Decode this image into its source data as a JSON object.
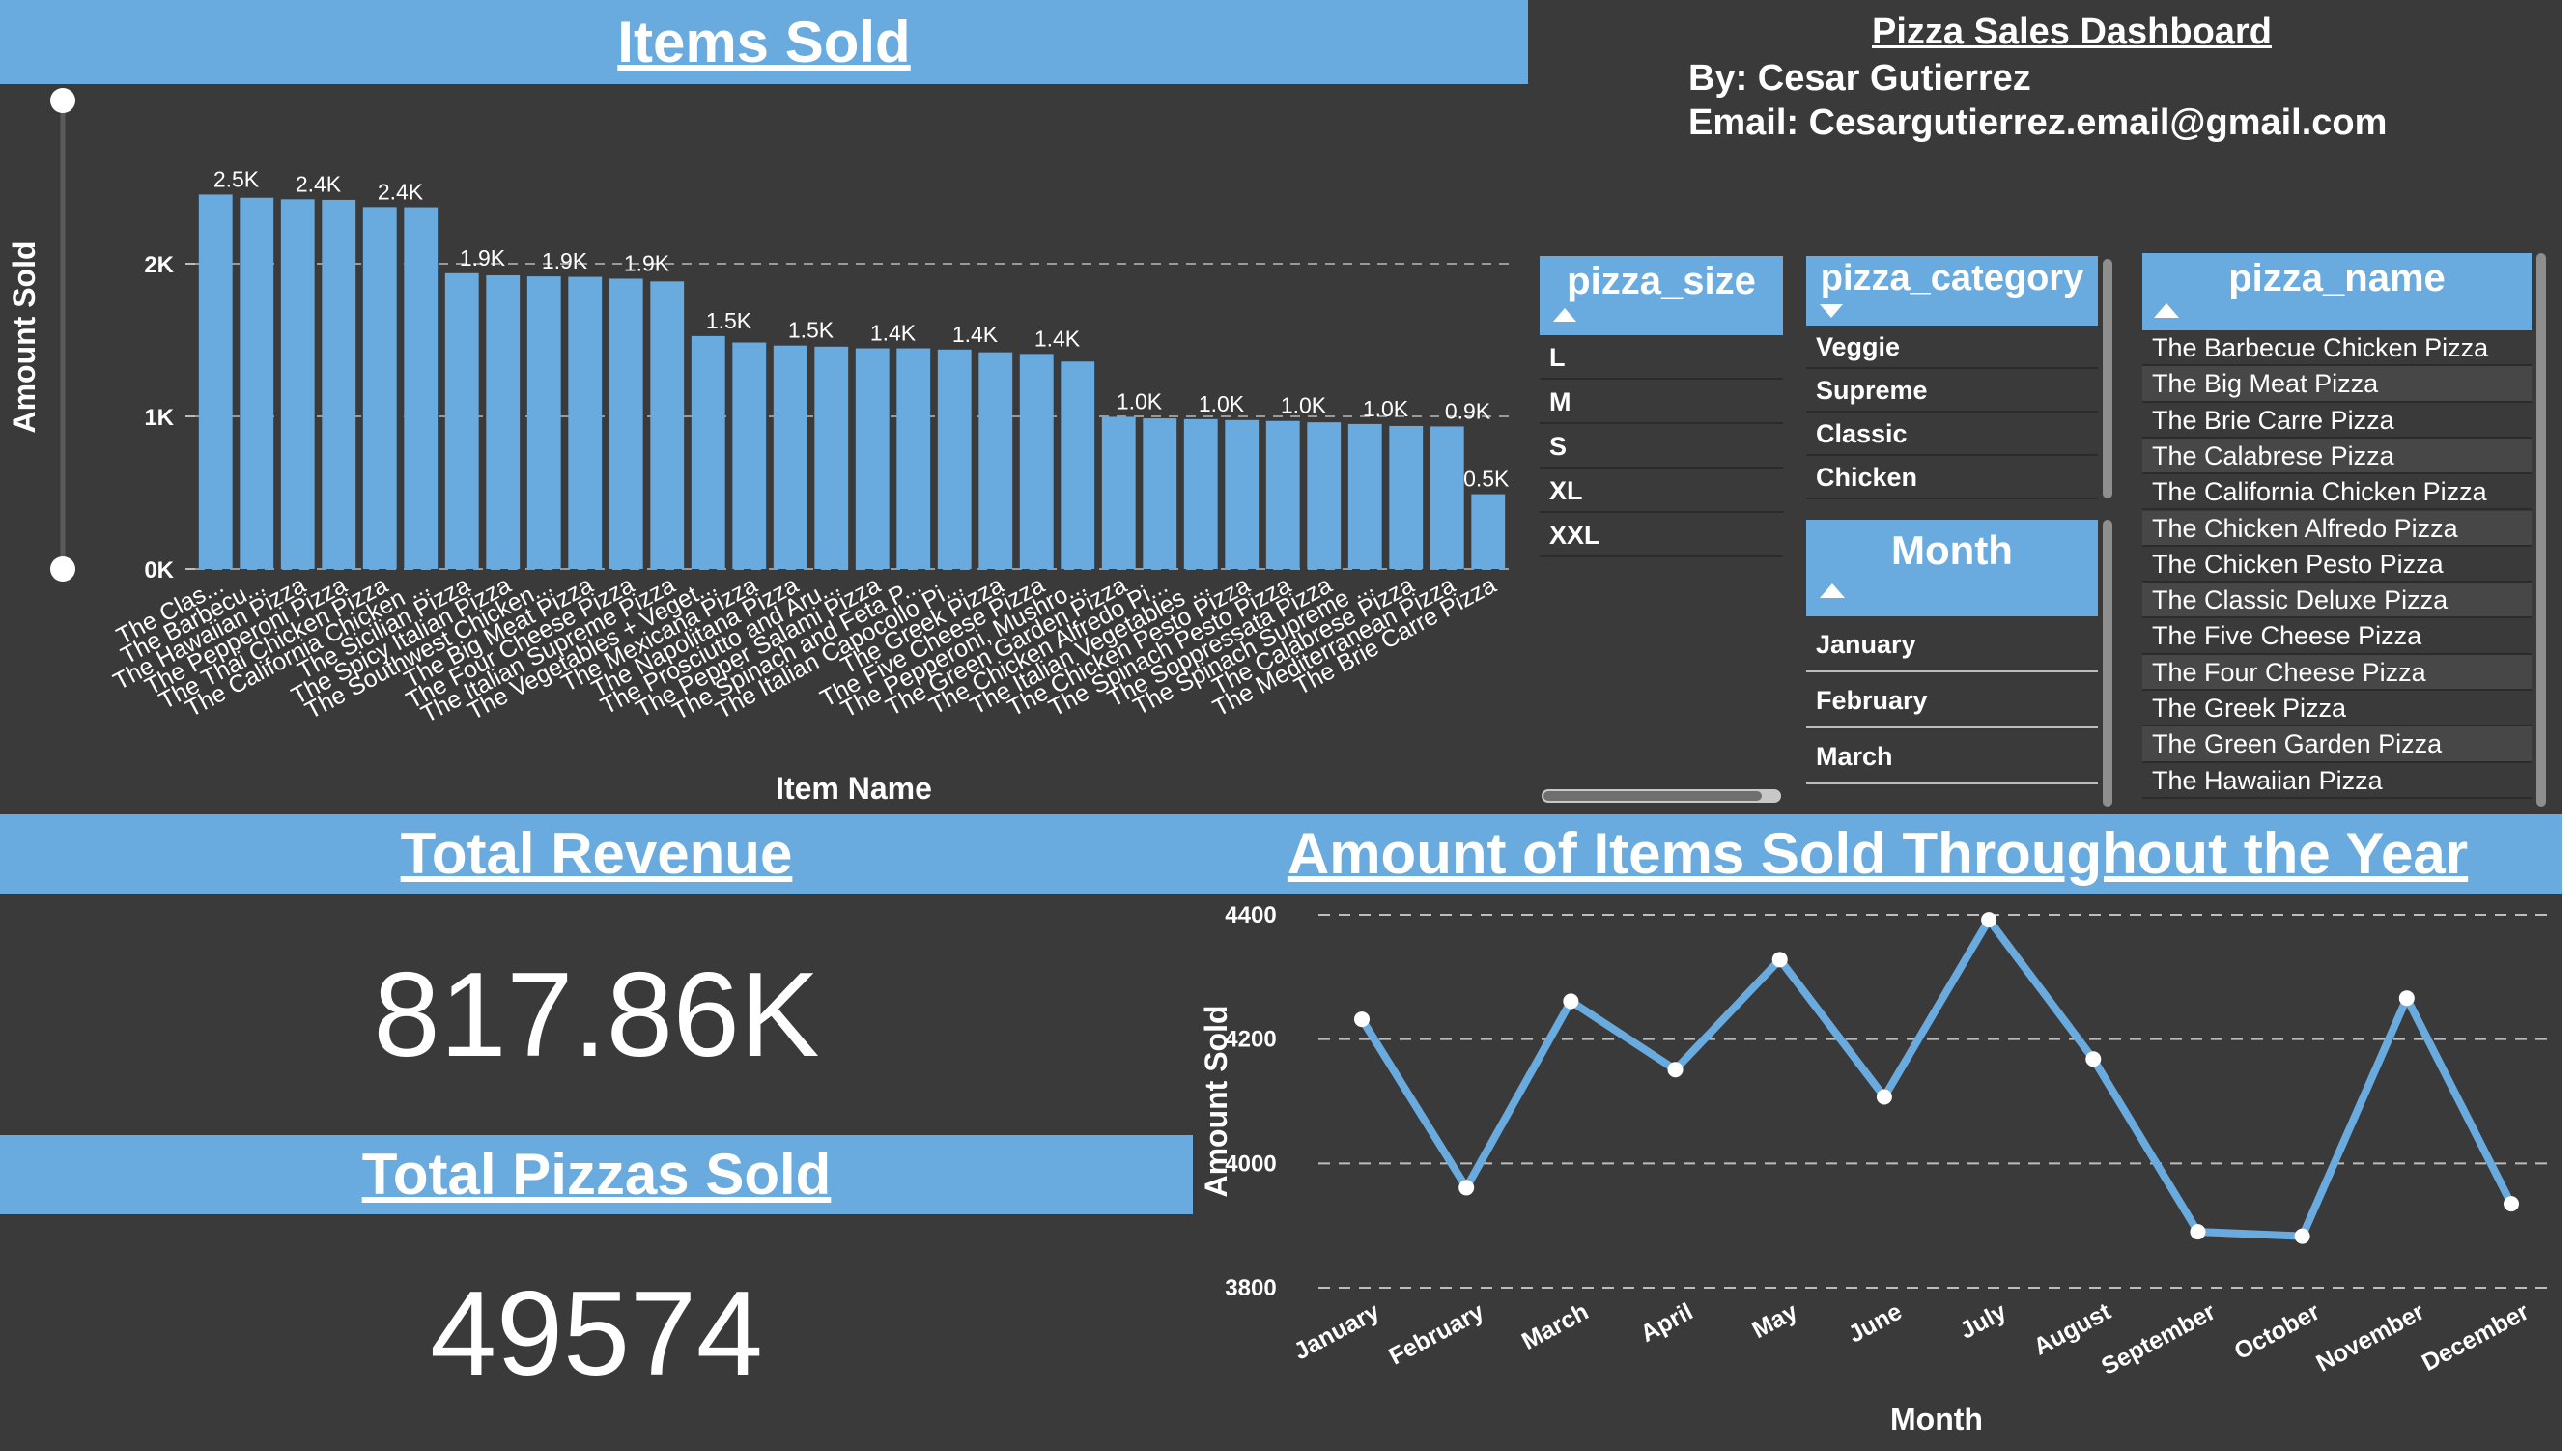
{
  "colors": {
    "accent": "#6aabdf",
    "panel": "#3a3a3a",
    "text": "#ffffff"
  },
  "items_chart": {
    "title": "Items Sold",
    "ylabel": "Amount Sold",
    "xlabel": "Item Name",
    "chart_data": {
      "type": "bar",
      "title": "Items Sold",
      "xlabel": "Item Name",
      "ylabel": "Amount Sold",
      "ylim": [
        0,
        2500
      ],
      "yticks": [
        {
          "v": 0,
          "label": "0K"
        },
        {
          "v": 1000,
          "label": "1K"
        },
        {
          "v": 2000,
          "label": "2K"
        }
      ],
      "categories": [
        "The Clas...",
        "The Barbecu...",
        "The Hawaiian Pizza",
        "The Pepperoni Pizza",
        "The Thai Chicken Pizza",
        "The California Chicken ...",
        "The Sicilian Pizza",
        "The Spicy Italian Pizza",
        "The Southwest Chicken...",
        "The Big Meat Pizza",
        "The Four Cheese Pizza",
        "The Italian Supreme Pizza",
        "The Vegetables + Veget...",
        "The Mexicana Pizza",
        "The Napolitana Pizza",
        "The Prosciutto and Aru...",
        "The Pepper Salami Pizza",
        "The Spinach and Feta P...",
        "The Italian Capocollo Pi...",
        "The Greek Pizza",
        "The Five Cheese Pizza",
        "The Pepperoni, Mushro...",
        "The Green Garden Pizza",
        "The Chicken Alfredo Pi...",
        "The Italian Vegetables ...",
        "The Chicken Pesto Pizza",
        "The Spinach Pesto Pizza",
        "The Soppressata Pizza",
        "The Spinach Supreme ...",
        "The Calabrese Pizza",
        "The Mediterranean Pizza",
        "The Brie Carre Pizza"
      ],
      "values": [
        2453,
        2432,
        2422,
        2418,
        2371,
        2370,
        1938,
        1924,
        1917,
        1914,
        1902,
        1884,
        1526,
        1484,
        1464,
        1457,
        1446,
        1446,
        1438,
        1420,
        1409,
        1359,
        997,
        987,
        982,
        976,
        970,
        961,
        950,
        937,
        934,
        490
      ],
      "labels": [
        {
          "i": 0,
          "text": "2.5K"
        },
        {
          "i": 2,
          "text": "2.4K"
        },
        {
          "i": 4,
          "text": "2.4K"
        },
        {
          "i": 6,
          "text": "1.9K"
        },
        {
          "i": 8,
          "text": "1.9K"
        },
        {
          "i": 10,
          "text": "1.9K"
        },
        {
          "i": 12,
          "text": "1.5K"
        },
        {
          "i": 14,
          "text": "1.5K"
        },
        {
          "i": 16,
          "text": "1.4K"
        },
        {
          "i": 18,
          "text": "1.4K"
        },
        {
          "i": 20,
          "text": "1.4K"
        },
        {
          "i": 22,
          "text": "1.0K"
        },
        {
          "i": 24,
          "text": "1.0K"
        },
        {
          "i": 26,
          "text": "1.0K"
        },
        {
          "i": 28,
          "text": "1.0K"
        },
        {
          "i": 30,
          "text": "0.9K"
        },
        {
          "i": 31,
          "text": "0.5K"
        }
      ]
    }
  },
  "info": {
    "title": "Pizza Sales Dashboard ",
    "by": "By: Cesar Gutierrez",
    "email": "Email: Cesargutierrez.email@gmail.com"
  },
  "slicers": {
    "size": {
      "header": "pizza_size",
      "items": [
        "L",
        "M",
        "S",
        "XL",
        "XXL"
      ]
    },
    "category": {
      "header": "pizza_category",
      "items": [
        "Veggie",
        "Supreme",
        "Classic",
        "Chicken"
      ]
    },
    "month": {
      "header": "Month",
      "items": [
        "January",
        "February",
        "March"
      ]
    },
    "name": {
      "header": "pizza_name",
      "items": [
        "The Barbecue Chicken Pizza",
        "The Big Meat Pizza",
        "The Brie Carre Pizza",
        "The Calabrese Pizza",
        "The California Chicken Pizza",
        "The Chicken Alfredo Pizza",
        "The Chicken Pesto Pizza",
        "The Classic Deluxe Pizza",
        "The Five Cheese Pizza",
        "The Four Cheese Pizza",
        "The Greek Pizza",
        "The Green Garden Pizza",
        "The Hawaiian Pizza"
      ]
    }
  },
  "kpi": {
    "revenue_title": "Total Revenue",
    "revenue_value": "817.86K",
    "pizzas_title": "Total Pizzas Sold",
    "pizzas_value": "49574"
  },
  "month_chart": {
    "title": "Amount of Items Sold Throughout the Year",
    "ylabel": "Amount Sold",
    "xlabel": "Month",
    "chart_data": {
      "type": "line",
      "title": "Amount of Items Sold Throughout the Year",
      "xlabel": "Month",
      "ylabel": "Amount Sold",
      "ylim": [
        3800,
        4400
      ],
      "yticks": [
        3800,
        4000,
        4200,
        4400
      ],
      "categories": [
        "January",
        "February",
        "March",
        "April",
        "May",
        "June",
        "July",
        "August",
        "September",
        "October",
        "November",
        "December"
      ],
      "values": [
        4232,
        3961,
        4261,
        4151,
        4328,
        4107,
        4392,
        4168,
        3890,
        3883,
        4266,
        3935
      ]
    }
  }
}
